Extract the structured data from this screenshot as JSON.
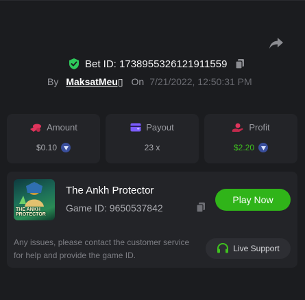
{
  "bet": {
    "id_label": "Bet ID: 1738955326121911559",
    "by_label": "By",
    "username": "MaksatMeu▯",
    "on_label": "On",
    "datetime": "7/21/2022, 12:50:31 PM"
  },
  "stats": {
    "amount": {
      "label": "Amount",
      "value": "$0.10",
      "icon": "coins-icon",
      "color": "#e0345c"
    },
    "payout": {
      "label": "Payout",
      "value": "23 x",
      "icon": "wallet-icon",
      "color": "#7b5cff"
    },
    "profit": {
      "label": "Profit",
      "value": "$2.20",
      "icon": "profit-hand-icon",
      "color": "#3fc11f"
    }
  },
  "game": {
    "thumbnail_title": "THE ANKH PROTECTOR",
    "name": "The Ankh Protector",
    "id_label": "Game ID: 9650537842",
    "play_label": "Play Now",
    "help_text": "Any issues, please contact the customer service for help and provide the game ID.",
    "support_label": "Live Support"
  },
  "colors": {
    "background": "#1b1c1f",
    "card": "#232428",
    "accent_green": "#30b419",
    "shield": "#2ec95b"
  }
}
